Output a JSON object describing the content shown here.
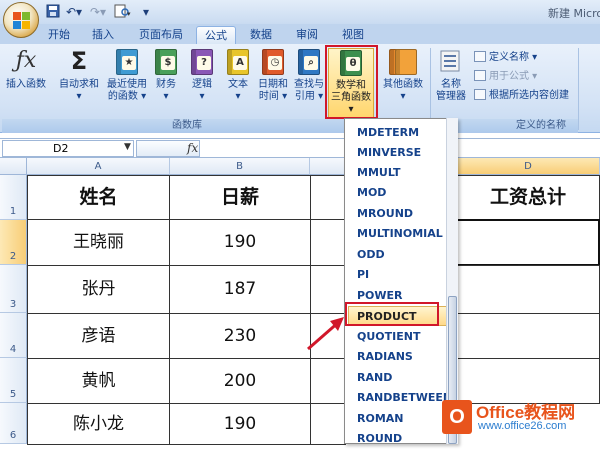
{
  "quick_access": {
    "save_icon": "save-icon",
    "undo_icon": "undo-icon",
    "redo_icon": "redo-icon",
    "print_preview_icon": "print-preview-icon"
  },
  "window": {
    "title": "新建 Micro"
  },
  "tabs": [
    {
      "label": "开始"
    },
    {
      "label": "插入"
    },
    {
      "label": "页面布局"
    },
    {
      "label": "公式"
    },
    {
      "label": "数据"
    },
    {
      "label": "审阅"
    },
    {
      "label": "视图"
    }
  ],
  "ribbon": {
    "insert_function": "插入函数",
    "autosum": "自动求和",
    "recent": [
      "最近使用",
      "的函数"
    ],
    "financial": "财务",
    "logical": "逻辑",
    "text": "文本",
    "datetime": [
      "日期和",
      "时间"
    ],
    "lookup": [
      "查找与",
      "引用"
    ],
    "math": [
      "数学和",
      "三角函数"
    ],
    "other": [
      "其他函数"
    ],
    "name_manager": [
      "名称",
      "管理器"
    ],
    "define_name": "定义名称",
    "use_in_formula": "用于公式",
    "create_from_selection": "根据所选内容创建",
    "group_library": "函数库",
    "group_names": "定义的名称",
    "accent_red": "#d1172a"
  },
  "formula_bar": {
    "name_box": "D2",
    "fx": "fx"
  },
  "columns": [
    "A",
    "B",
    "D"
  ],
  "rows": [
    "1",
    "2",
    "3",
    "4",
    "5",
    "6"
  ],
  "table": {
    "headers": [
      "姓名",
      "日薪",
      "工资总计"
    ],
    "names": [
      "王晓丽",
      "张丹",
      "彦语",
      "黄帆",
      "陈小龙"
    ],
    "wages": [
      "190",
      "187",
      "230",
      "200",
      "190"
    ]
  },
  "dropdown": {
    "items": [
      "MDETERM",
      "MINVERSE",
      "MMULT",
      "MOD",
      "MROUND",
      "MULTINOMIAL",
      "ODD",
      "PI",
      "POWER",
      "PRODUCT",
      "QUOTIENT",
      "RADIANS",
      "RAND",
      "RANDBETWEEN",
      "ROMAN",
      "ROUND"
    ],
    "highlighted": "PRODUCT"
  },
  "watermark": {
    "brand": "Office教程网",
    "url": "www.office26.com"
  }
}
